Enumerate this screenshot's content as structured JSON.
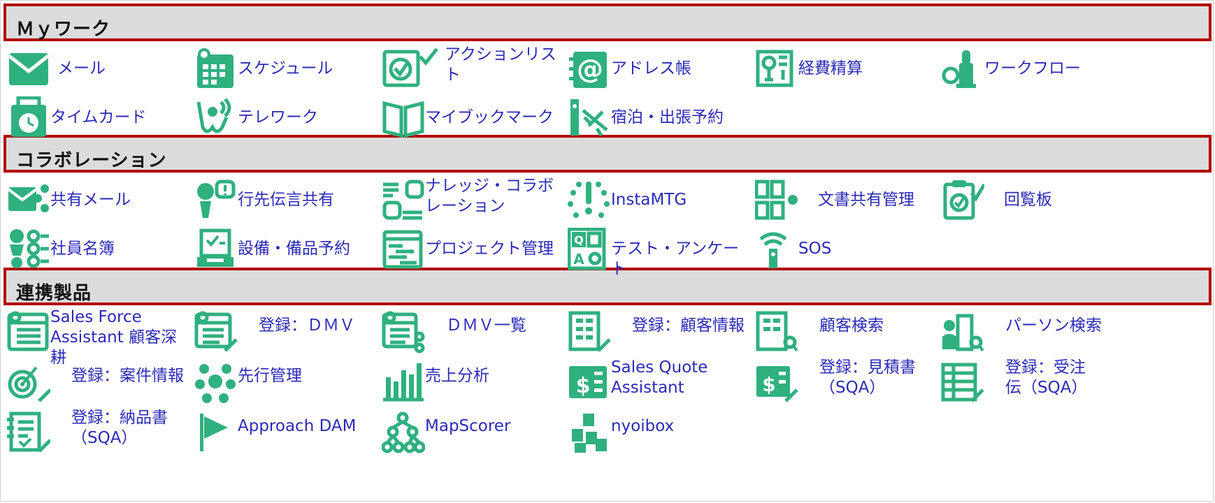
{
  "colors": {
    "accent": "#2fb07f",
    "link": "#2b2bb8",
    "header_bg": "#dcdcdc",
    "header_border": "#b30000"
  },
  "sections": [
    {
      "title": "Ｍｙワーク",
      "items": [
        {
          "label": "メール",
          "icon": "mail-icon"
        },
        {
          "label": "スケジュール",
          "icon": "calendar-icon"
        },
        {
          "label": "アクションリスト",
          "icon": "checkbox-icon"
        },
        {
          "label": "アドレス帳",
          "icon": "address-book-icon"
        },
        {
          "label": "経費精算",
          "icon": "expense-icon"
        },
        {
          "label": "ワークフロー",
          "icon": "stamp-icon"
        },
        {
          "label": "タイムカード",
          "icon": "timecard-icon"
        },
        {
          "label": "テレワーク",
          "icon": "telework-icon"
        },
        {
          "label": "マイブックマーク",
          "icon": "book-icon"
        },
        {
          "label": "宿泊・出張予約",
          "icon": "travel-icon"
        }
      ]
    },
    {
      "title": "コラボレーション",
      "items": [
        {
          "label": "共有メール",
          "icon": "shared-mail-icon"
        },
        {
          "label": "行先伝言共有",
          "icon": "message-icon"
        },
        {
          "label": "ナレッジ・コラボレーション",
          "icon": "knowledge-icon"
        },
        {
          "label": "InstaMTG",
          "icon": "insta-mtg-icon"
        },
        {
          "label": "文書共有管理",
          "icon": "document-share-icon"
        },
        {
          "label": "回覧板",
          "icon": "circular-icon"
        },
        {
          "label": "社員名簿",
          "icon": "directory-icon"
        },
        {
          "label": "設備・備品予約",
          "icon": "facility-icon"
        },
        {
          "label": "プロジェクト管理",
          "icon": "project-icon"
        },
        {
          "label": "テスト・アンケート",
          "icon": "quiz-icon"
        },
        {
          "label": "SOS",
          "icon": "sos-icon"
        }
      ]
    },
    {
      "title": "連携製品",
      "items": [
        {
          "label": "Sales Force Assistant 顧客深耕",
          "icon": "list-icon"
        },
        {
          "label": "登録：ＤＭＶ",
          "icon": "list-edit-icon"
        },
        {
          "label": "ＤＭＶ一覧",
          "icon": "list-share-icon"
        },
        {
          "label": "登録：顧客情報",
          "icon": "building-edit-icon"
        },
        {
          "label": "顧客検索",
          "icon": "building-search-icon"
        },
        {
          "label": "パーソン検索",
          "icon": "person-search-icon"
        },
        {
          "label": "登録：案件情報",
          "icon": "target-edit-icon"
        },
        {
          "label": "先行管理",
          "icon": "network-icon"
        },
        {
          "label": "売上分析",
          "icon": "bar-chart-icon"
        },
        {
          "label": "Sales Quote Assistant",
          "icon": "quote-icon"
        },
        {
          "label": "登録：見積書（SQA）",
          "icon": "quote-edit-icon"
        },
        {
          "label": "登録：受注伝（SQA）",
          "icon": "order-edit-icon"
        },
        {
          "label": "登録：納品書（SQA）",
          "icon": "delivery-edit-icon"
        },
        {
          "label": "Approach DAM",
          "icon": "flag-icon"
        },
        {
          "label": "MapScorer",
          "icon": "hierarchy-icon"
        },
        {
          "label": "nyoibox",
          "icon": "boxes-icon"
        }
      ]
    }
  ]
}
